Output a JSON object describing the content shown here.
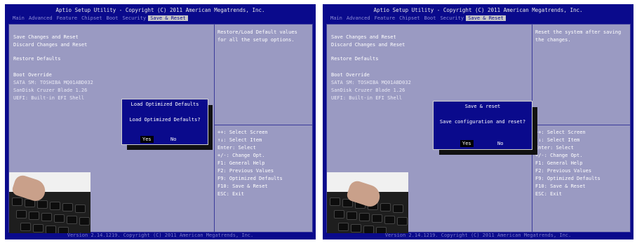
{
  "title": "Aptio Setup Utility - Copyright (C) 2011 American Megatrends, Inc.",
  "footer": "Version 2.14.1219. Copyright (C) 2011 American Megatrends, Inc.",
  "menu": [
    "Main",
    "Advanced",
    "Feature",
    "Chipset",
    "Boot",
    "Security",
    "Save & Reset"
  ],
  "active_menu": "Save & Reset",
  "options": {
    "save_changes_reset": "Save Changes and Reset",
    "discard_changes_reset": "Discard Changes and Reset",
    "restore_defaults": "Restore Defaults",
    "boot_override": "Boot Override",
    "boot_sata": "SATA  SM: TOSHIBA MQ01ABD032",
    "boot_sandisk": "SanDisk Cruzer Blade 1.26",
    "boot_uefi": "UEFI: Built-in EFI Shell"
  },
  "keys": [
    "++: Select Screen",
    "↑↓: Select Item",
    "Enter: Select",
    "+/-: Change Opt.",
    "F1: General Help",
    "F2: Previous Values",
    "F9: Optimized Defaults",
    "F10: Save & Reset",
    "ESC: Exit"
  ],
  "left": {
    "help": "Restore/Load Default values\nfor all the setup options.",
    "dialog": {
      "title": "Load Optimized Defaults",
      "message": "Load Optimized Defaults?",
      "yes": "Yes",
      "no": "No",
      "selected": "Yes"
    }
  },
  "right": {
    "help": "Reset the system after saving\nthe changes.",
    "dialog": {
      "title": "Save & reset",
      "message": "Save configuration and reset?",
      "yes": "Yes",
      "no": "No",
      "selected": "Yes"
    }
  },
  "colors": {
    "bios_blue": "#0a0a8c",
    "panel": "#9a9ac2",
    "highlight": "#c6c6c6",
    "menu_text": "#8c8cd6"
  }
}
